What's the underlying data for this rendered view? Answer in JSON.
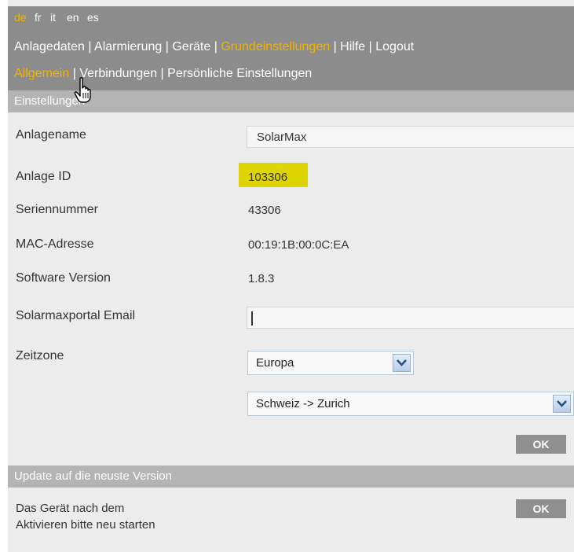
{
  "languages": [
    {
      "code": "de",
      "active": true
    },
    {
      "code": "fr",
      "active": false
    },
    {
      "code": "it",
      "active": false
    },
    {
      "code": "en",
      "active": false
    },
    {
      "code": "es",
      "active": false
    }
  ],
  "main_menu": {
    "items": [
      "Anlagedaten",
      "Alarmierung",
      "Geräte",
      "Grundeinstellungen",
      "Hilfe",
      "Logout"
    ],
    "active": "Grundeinstellungen",
    "separator": "|"
  },
  "sub_menu": {
    "items": [
      "Allgemein",
      "Verbindungen",
      "Persönliche Einstellungen"
    ],
    "active": "Allgemein",
    "separator": "|"
  },
  "settings": {
    "header": "Einstellungen",
    "plant_name": {
      "label": "Anlagename",
      "value": "SolarMax"
    },
    "plant_id": {
      "label": "Anlage ID",
      "value": "103306"
    },
    "serial": {
      "label": "Seriennummer",
      "value": "43306"
    },
    "mac": {
      "label": "MAC-Adresse",
      "value": "00:19:1B:00:0C:EA"
    },
    "software": {
      "label": "Software Version",
      "value": "1.8.3"
    },
    "email": {
      "label": "Solarmaxportal Email",
      "value": ""
    },
    "timezone": {
      "label": "Zeitzone",
      "region": "Europa",
      "city": "Schweiz -> Zurich"
    },
    "ok_label": "OK"
  },
  "update": {
    "header": "Update auf die neuste Version",
    "note_line1": "Das Gerät nach dem",
    "note_line2": "Aktivieren bitte neu starten",
    "ok_label": "OK"
  },
  "colors": {
    "bar": "#8c8c8c",
    "section": "#b4b4b4",
    "accent": "#f0b400",
    "highlight": "#ddd400"
  },
  "icons": {
    "cursor": "hand-pointer-icon",
    "dropdown": "chevron-down-icon"
  }
}
